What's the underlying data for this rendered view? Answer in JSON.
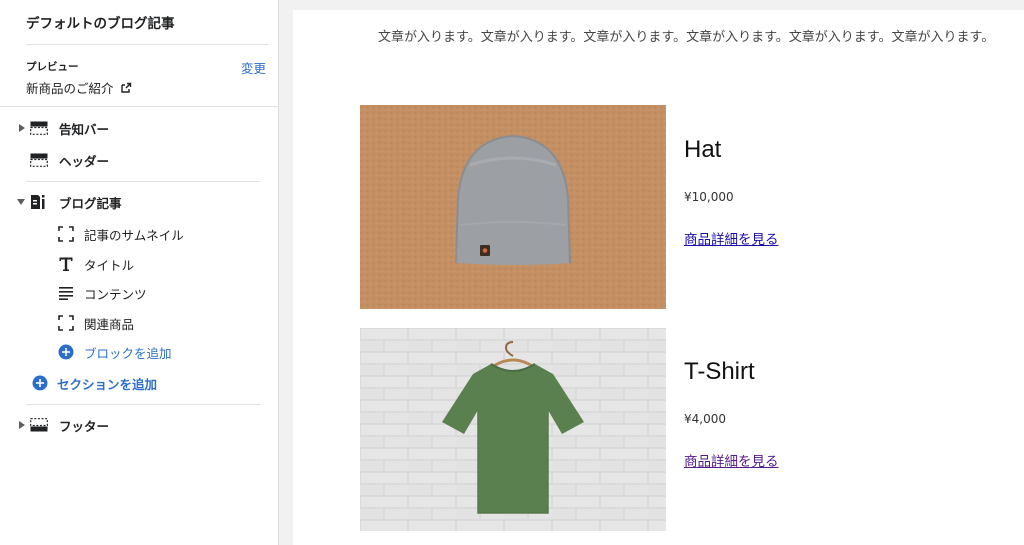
{
  "sidebar": {
    "title": "デフォルトのブログ記事",
    "preview_label": "プレビュー",
    "preview_value": "新商品のご紹介",
    "change_label": "変更",
    "sections": [
      {
        "label": "告知バー",
        "icon": "announcement-bar-icon",
        "expanded": false
      },
      {
        "label": "ヘッダー",
        "icon": "header-icon"
      },
      {
        "label": "ブログ記事",
        "icon": "blog-post-icon",
        "expanded": true,
        "blocks": [
          {
            "label": "記事のサムネイル",
            "icon": "thumbnail-frame-icon"
          },
          {
            "label": "タイトル",
            "icon": "title-t-icon"
          },
          {
            "label": "コンテンツ",
            "icon": "content-lines-icon"
          },
          {
            "label": "関連商品",
            "icon": "related-products-frame-icon"
          }
        ],
        "add_block_label": "ブロックを追加"
      },
      {
        "label": "フッター",
        "icon": "footer-icon",
        "expanded": false
      }
    ],
    "add_section_label": "セクションを追加"
  },
  "preview": {
    "paragraph": "文章が入ります。文章が入ります。文章が入ります。文章が入ります。文章が入ります。文章が入ります。",
    "products": [
      {
        "name": "Hat",
        "price": "¥10,000",
        "link": "商品詳細を見る",
        "image": "gray-beanie-on-cardboard"
      },
      {
        "name": "T-Shirt",
        "price": "¥4,000",
        "link": "商品詳細を見る",
        "image": "green-tshirt-on-brick-wall"
      }
    ]
  },
  "colors": {
    "accent_blue": "#2c6ecb",
    "link_blue": "#1a0dab",
    "link_visited": "#551a8b",
    "text": "#202223"
  }
}
